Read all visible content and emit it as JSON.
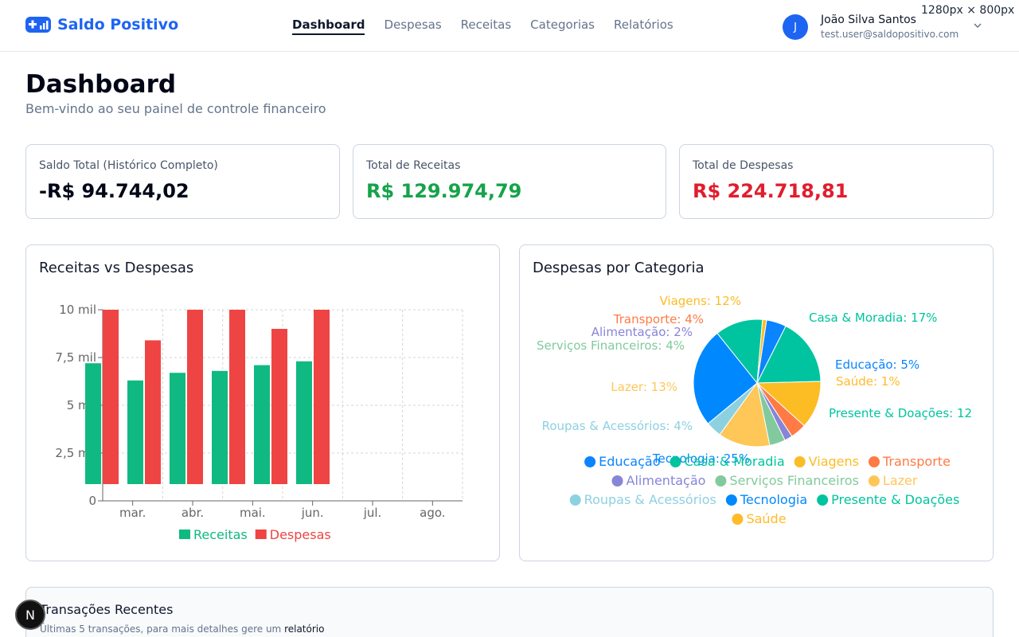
{
  "app": {
    "name": "Saldo Positivo"
  },
  "nav": [
    {
      "label": "Dashboard",
      "active": true
    },
    {
      "label": "Despesas"
    },
    {
      "label": "Receitas"
    },
    {
      "label": "Categorias"
    },
    {
      "label": "Relatórios"
    }
  ],
  "user": {
    "initial": "J",
    "name": "João Silva Santos",
    "email": "test.user@saldopositivo.com"
  },
  "screen_size_label": "1280px × 800px",
  "page": {
    "title": "Dashboard",
    "subtitle": "Bem-vindo ao seu painel de controle financeiro"
  },
  "stats": [
    {
      "label": "Saldo Total (Histórico Completo)",
      "value": "-R$ 94.744,02",
      "color": "#020617"
    },
    {
      "label": "Total de Receitas",
      "value": "R$ 129.974,79",
      "color": "#16a34a"
    },
    {
      "label": "Total de Despesas",
      "value": "R$ 224.718,81",
      "color": "#e11d2e"
    }
  ],
  "bar_chart_title": "Receitas vs Despesas",
  "pie_chart_title": "Despesas por Categoria",
  "chart_data": [
    {
      "type": "bar",
      "categories": [
        "mar.",
        "abr.",
        "mai.",
        "jun.",
        "jul.",
        "ago."
      ],
      "y_ticks": [
        "0",
        "2,5 mil",
        "5 mil",
        "7,5 mil",
        "10 mil"
      ],
      "ylim": [
        0,
        10000
      ],
      "grid": true,
      "legend": "bottom",
      "series": [
        {
          "name": "Receitas",
          "color": "#10b981",
          "values": [
            7200,
            6300,
            6700,
            6800,
            7100,
            7300
          ]
        },
        {
          "name": "Despesas",
          "color": "#ef4444",
          "values": [
            10000,
            8400,
            10000,
            10000,
            9000,
            10000
          ]
        }
      ]
    },
    {
      "type": "pie",
      "legend": "bottom",
      "slices": [
        {
          "label": "Educação",
          "value": 5,
          "color": "#0a84ff"
        },
        {
          "label": "Casa & Moradia",
          "value": 17,
          "color": "#00c49f"
        },
        {
          "label": "Viagens",
          "value": 12,
          "color": "#fbbc24"
        },
        {
          "label": "Transporte",
          "value": 4,
          "color": "#ff7a45"
        },
        {
          "label": "Alimentação",
          "value": 2,
          "color": "#8884d8"
        },
        {
          "label": "Serviços Financeiros",
          "value": 4,
          "color": "#82ca9d"
        },
        {
          "label": "Lazer",
          "value": 13,
          "color": "#ffc658"
        },
        {
          "label": "Roupas & Acessórios",
          "value": 4,
          "color": "#8dd1e1"
        },
        {
          "label": "Tecnologia",
          "value": 25,
          "color": "#0088fe"
        },
        {
          "label": "Presente & Doações",
          "value": 12,
          "color": "#00c49f"
        },
        {
          "label": "Saúde",
          "value": 1,
          "color": "#ffbb28"
        }
      ],
      "slice_labels": [
        "Educação: 5%",
        "Casa & Moradia: 17%",
        "Viagens: 12%",
        "Transporte: 4%",
        "Alimentação: 2%",
        "Serviços Financeiros: 4%",
        "Lazer: 13%",
        "Roupas & Acessórios: 4%",
        "Tecnologia: 25%",
        "Presente & Doações: 12",
        "Saúde: 1%"
      ]
    }
  ],
  "transactions": {
    "title": "Transações Recentes",
    "subtitle": "Últimas 5 transações, para mais detalhes gere um ",
    "link": "relatório"
  },
  "framework_badge": "N"
}
